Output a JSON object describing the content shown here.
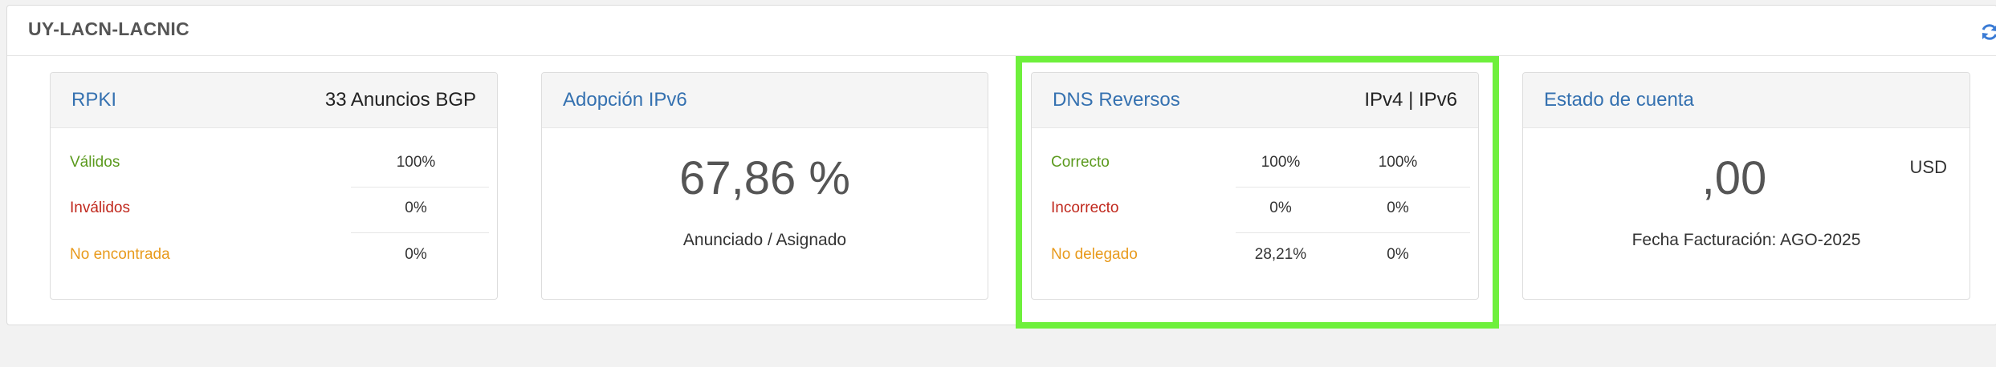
{
  "header": {
    "title": "UY-LACN-LACNIC",
    "refresh_icon": "refresh-icon"
  },
  "rpki": {
    "title": "RPKI",
    "announcements": "33 Anuncios BGP",
    "rows": [
      {
        "label": "Válidos",
        "value": "100%"
      },
      {
        "label": "Inválidos",
        "value": "0%"
      },
      {
        "label": "No encontrada",
        "value": "0%"
      }
    ]
  },
  "ipv6": {
    "title": "Adopción IPv6",
    "value": "67,86 %",
    "caption": "Anunciado / Asignado"
  },
  "dns": {
    "title": "DNS Reversos",
    "header_right": "IPv4 | IPv6",
    "rows": [
      {
        "label": "Correcto",
        "ipv4": "100%",
        "ipv6": "100%"
      },
      {
        "label": "Incorrecto",
        "ipv4": "0%",
        "ipv6": "0%"
      },
      {
        "label": "No delegado",
        "ipv4": "28,21%",
        "ipv6": "0%"
      }
    ]
  },
  "account": {
    "title": "Estado de cuenta",
    "amount": ",00",
    "currency": "USD",
    "billing": "Fecha Facturación: AGO-2025"
  },
  "colors": {
    "link": "#3571b0",
    "valid": "#5b9a1e",
    "invalid": "#c0271c",
    "notfound": "#e89a1c",
    "highlight": "#6ef03c"
  }
}
